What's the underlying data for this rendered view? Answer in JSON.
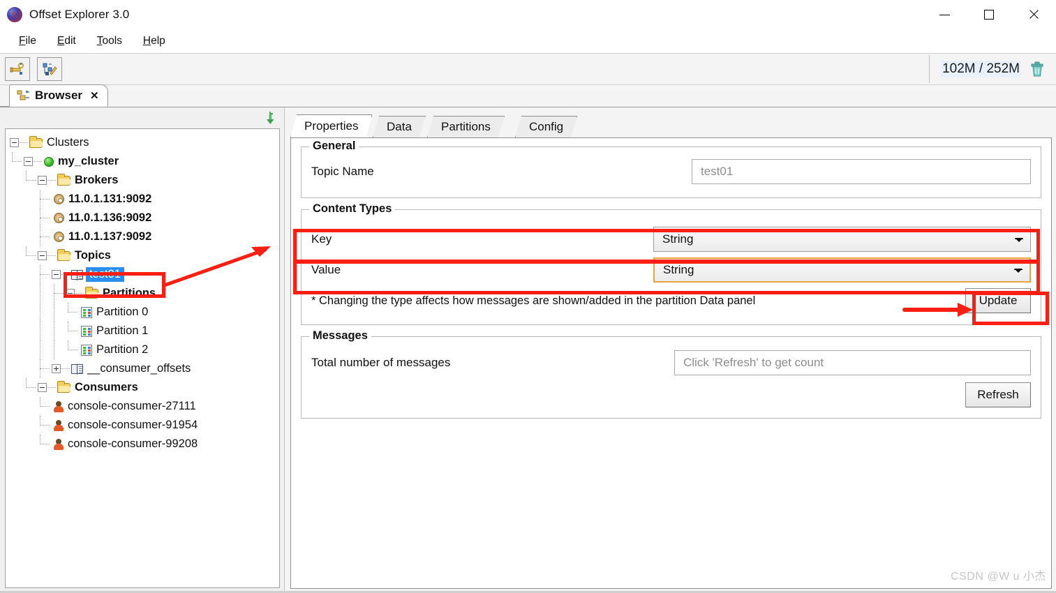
{
  "window": {
    "title": "Offset Explorer  3.0",
    "app_icon": "offset-explorer-logo",
    "minimize": "minimize-icon",
    "maximize": "maximize-icon",
    "close": "close-icon"
  },
  "menubar": {
    "items": [
      {
        "label": "File",
        "mnemonic": "F"
      },
      {
        "label": "Edit",
        "mnemonic": "E"
      },
      {
        "label": "Tools",
        "mnemonic": "T"
      },
      {
        "label": "Help",
        "mnemonic": "H"
      }
    ]
  },
  "toolbar": {
    "buttons": [
      {
        "name": "add-connection-button",
        "icon": "plug-connect-icon"
      },
      {
        "name": "edit-cluster-button",
        "icon": "tree-edit-pencil-icon"
      }
    ],
    "memory": {
      "text": "102M / 252M",
      "used": "102M",
      "total": "252M",
      "gc_icon": "trash-icon"
    }
  },
  "tabstrip": {
    "tabs": [
      {
        "label": "Browser",
        "icon": "browser-tree-icon",
        "close": "✕",
        "active": true
      }
    ]
  },
  "left_pane": {
    "collapse_all_icon": "green-down-arrow-icon",
    "tree": {
      "root": "Clusters",
      "nodes": [
        {
          "id": "clusters",
          "label": "Clusters",
          "depth": 0,
          "icon": "folder-icon",
          "expander": "minus",
          "bold": false
        },
        {
          "id": "my_cluster",
          "label": "my_cluster",
          "depth": 1,
          "icon": "green-status-dot-icon",
          "expander": "minus",
          "bold": true
        },
        {
          "id": "brokers",
          "label": "Brokers",
          "depth": 2,
          "icon": "folder-icon",
          "expander": "minus",
          "bold": true
        },
        {
          "id": "broker1",
          "label": "11.0.1.131:9092",
          "depth": 3,
          "icon": "gear-icon",
          "expander": "none",
          "bold": true
        },
        {
          "id": "broker2",
          "label": "11.0.1.136:9092",
          "depth": 3,
          "icon": "gear-icon",
          "expander": "none",
          "bold": true
        },
        {
          "id": "broker3",
          "label": "11.0.1.137:9092",
          "depth": 3,
          "icon": "gear-icon",
          "expander": "none",
          "bold": true
        },
        {
          "id": "topics",
          "label": "Topics",
          "depth": 2,
          "icon": "folder-icon",
          "expander": "minus",
          "bold": true
        },
        {
          "id": "test01",
          "label": "test01",
          "depth": 3,
          "icon": "topic-icon",
          "expander": "minus",
          "bold": false,
          "selected": true
        },
        {
          "id": "partitions",
          "label": "Partitions",
          "depth": 4,
          "icon": "folder-icon",
          "expander": "minus",
          "bold": true
        },
        {
          "id": "partition0",
          "label": "Partition 0",
          "depth": 5,
          "icon": "partition-icon",
          "expander": "none",
          "bold": false
        },
        {
          "id": "partition1",
          "label": "Partition 1",
          "depth": 5,
          "icon": "partition-icon",
          "expander": "none",
          "bold": false
        },
        {
          "id": "partition2",
          "label": "Partition 2",
          "depth": 5,
          "icon": "partition-icon",
          "expander": "none",
          "bold": false
        },
        {
          "id": "consumer_offsets",
          "label": "__consumer_offsets",
          "depth": 3,
          "icon": "topic-icon",
          "expander": "plus",
          "bold": false
        },
        {
          "id": "consumers",
          "label": "Consumers",
          "depth": 2,
          "icon": "folder-icon",
          "expander": "minus",
          "bold": true
        },
        {
          "id": "cc27111",
          "label": "console-consumer-27111",
          "depth": 3,
          "icon": "consumer-user-icon",
          "expander": "none",
          "bold": false
        },
        {
          "id": "cc91954",
          "label": "console-consumer-91954",
          "depth": 3,
          "icon": "consumer-user-icon",
          "expander": "none",
          "bold": false
        },
        {
          "id": "cc99208",
          "label": "console-consumer-99208",
          "depth": 3,
          "icon": "consumer-user-icon",
          "expander": "none",
          "bold": false
        }
      ]
    }
  },
  "right_pane": {
    "tabs": [
      {
        "label": "Properties",
        "active": true
      },
      {
        "label": "Data",
        "active": false
      },
      {
        "label": "Partitions",
        "active": false
      },
      {
        "label": "Config",
        "active": false
      }
    ],
    "general": {
      "title": "General",
      "topic_name_label": "Topic Name",
      "topic_name_value": "test01"
    },
    "content_types": {
      "title": "Content Types",
      "key_label": "Key",
      "key_value": "String",
      "value_label": "Value",
      "value_value": "String",
      "note": "* Changing the type affects how messages are shown/added in the partition Data panel",
      "update_label": "Update"
    },
    "messages": {
      "title": "Messages",
      "total_label": "Total number of messages",
      "total_placeholder": "Click 'Refresh' to get count",
      "refresh_label": "Refresh"
    }
  },
  "annotations": {
    "highlight_color": "#fb1e12",
    "boxes": [
      {
        "name": "topic-node-highlight"
      },
      {
        "name": "key-row-highlight"
      },
      {
        "name": "value-row-highlight"
      },
      {
        "name": "update-button-highlight"
      }
    ],
    "arrows": [
      {
        "name": "tree-to-content-types-arrow"
      },
      {
        "name": "note-to-update-arrow"
      }
    ]
  },
  "watermark": {
    "text": "CSDN @W u 小杰"
  }
}
